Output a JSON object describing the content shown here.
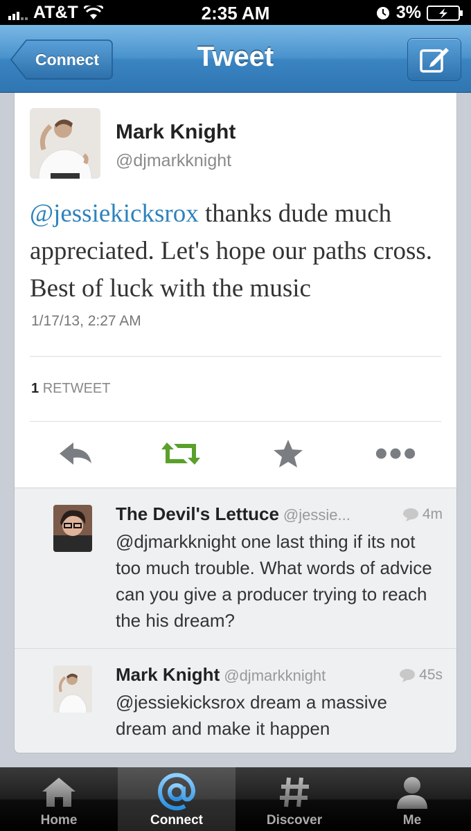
{
  "status_bar": {
    "carrier": "AT&T",
    "time": "2:35 AM",
    "battery": "3%"
  },
  "nav": {
    "back_label": "Connect",
    "title": "Tweet"
  },
  "tweet": {
    "author_name": "Mark Knight",
    "author_handle": "@djmarkknight",
    "mention": "@jessiekicksrox",
    "text": " thanks dude much appreciated. Let's hope our paths cross. Best of luck with the music",
    "timestamp": "1/17/13, 2:27 AM",
    "retweet_count": "1",
    "retweet_label": "RETWEET"
  },
  "actions": [
    "reply-icon",
    "retweet-icon",
    "favorite-icon",
    "more-icon"
  ],
  "replies": [
    {
      "name": "The Devil's Lettuce",
      "handle": "@jessie...",
      "time": "4m",
      "text": "@djmarkknight one last thing if its not too much trouble. What words of advice can you give a producer trying to reach the his dream?"
    },
    {
      "name": "Mark Knight",
      "handle": "@djmarkknight",
      "time": "45s",
      "text": "@jessiekicksrox dream a massive dream and make it happen"
    }
  ],
  "tabs": [
    {
      "label": "Home",
      "icon": "home-icon"
    },
    {
      "label": "Connect",
      "icon": "at-icon",
      "active": true
    },
    {
      "label": "Discover",
      "icon": "hash-icon"
    },
    {
      "label": "Me",
      "icon": "person-icon"
    }
  ],
  "colors": {
    "nav_blue": "#3a84c2",
    "link_blue": "#2d83bc",
    "retweet_green": "#5aa02c"
  }
}
